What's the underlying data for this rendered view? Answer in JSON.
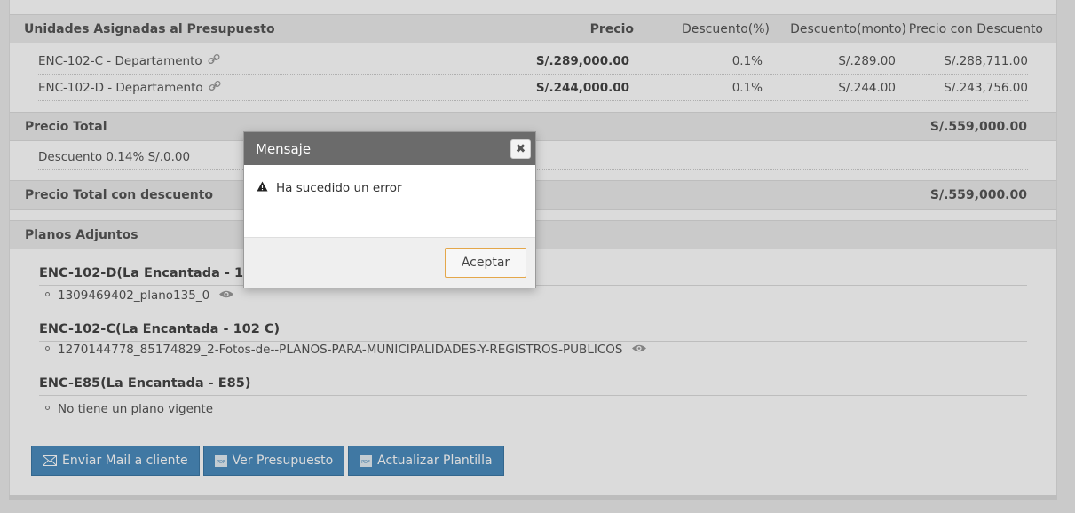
{
  "units": {
    "header": {
      "name": "Unidades Asignadas al Presupuesto",
      "precio": "Precio",
      "descuento_pct": "Descuento(%)",
      "descuento_monto": "Descuento(monto)",
      "precio_con_descuento": "Precio con Descuento"
    },
    "rows": [
      {
        "name": "ENC-102-C - Departamento",
        "precio": "S/.289,000.00",
        "descuento_pct": "0.1%",
        "descuento_monto": "S/.289.00",
        "precio_con_descuento": "S/.288,711.00"
      },
      {
        "name": "ENC-102-D - Departamento",
        "precio": "S/.244,000.00",
        "descuento_pct": "0.1%",
        "descuento_monto": "S/.244.00",
        "precio_con_descuento": "S/.243,756.00"
      }
    ]
  },
  "totals": {
    "precio_total_label": "Precio Total",
    "precio_total_value": "S/.559,000.00",
    "descuento_text": "Descuento 0.14% S/.0.00",
    "total_con_descuento_label": "Precio Total con descuento",
    "total_con_descuento_value": "S/.559,000.00"
  },
  "planos": {
    "title": "Planos Adjuntos",
    "groups": [
      {
        "title": "ENC-102-D(La Encantada - 102 D)",
        "item": "1309469402_plano135_0"
      },
      {
        "title": "ENC-102-C(La Encantada - 102 C)",
        "item": "1270144778_85174829_2-Fotos-de--PLANOS-PARA-MUNICIPALIDADES-Y-REGISTROS-PUBLICOS"
      },
      {
        "title": "ENC-E85(La Encantada - E85)",
        "item": "No tiene un plano vigente"
      }
    ]
  },
  "actions": {
    "mail": "Enviar Mail a cliente",
    "ver": "Ver Presupuesto",
    "actualizar": "Actualizar Plantilla"
  },
  "dialog": {
    "title": "Mensaje",
    "message": "Ha sucedido un error",
    "ok": "Aceptar",
    "close_icon": "close-icon",
    "warning_icon": "warning-icon"
  },
  "colors": {
    "button_blue": "#4b8cbe",
    "dialog_header": "#6b6b6b",
    "ok_border": "#e4a74a"
  }
}
